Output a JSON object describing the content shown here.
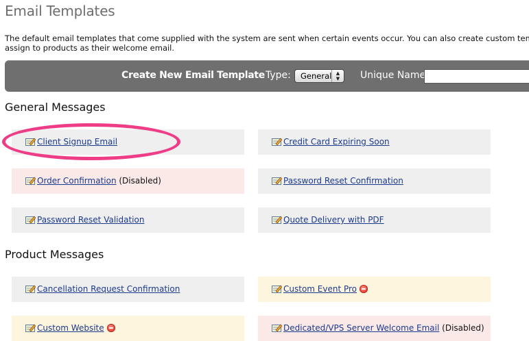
{
  "page": {
    "title": "Email Templates",
    "intro_line1": "The default email templates that come supplied with the system are sent when certain events occur. You can also create custom templates which you can",
    "intro_line2": "assign to products as their welcome email."
  },
  "create_bar": {
    "title": "Create New Email Template",
    "type_label": "Type:",
    "type_value": "General",
    "unique_name_label": "Unique Name:",
    "unique_name_value": ""
  },
  "sections": {
    "general_title": "General Messages",
    "product_title": "Product Messages"
  },
  "general_templates": [
    {
      "label": "Client Signup Email",
      "suffix": "",
      "status": "normal"
    },
    {
      "label": "Credit Card Expiring Soon",
      "suffix": "",
      "status": "normal"
    },
    {
      "label": "Order Confirmation",
      "suffix": " (Disabled)",
      "status": "disabled"
    },
    {
      "label": "Password Reset Confirmation",
      "suffix": "",
      "status": "normal"
    },
    {
      "label": "Password Reset Validation",
      "suffix": "",
      "status": "normal"
    },
    {
      "label": "Quote Delivery with PDF",
      "suffix": "",
      "status": "normal"
    }
  ],
  "product_templates": [
    {
      "label": "Cancellation Request Confirmation",
      "suffix": "",
      "status": "normal"
    },
    {
      "label": "Custom Event Pro",
      "suffix": "",
      "status": "custom",
      "delete_icon": "delete-icon"
    },
    {
      "label": "Custom Website",
      "suffix": "",
      "status": "custom",
      "delete_icon": "delete-icon"
    },
    {
      "label": "Dedicated/VPS Server Welcome Email",
      "suffix": " (Disabled)",
      "status": "disabled"
    }
  ],
  "icons": {
    "edit": "edit-template-icon",
    "delete": "delete-icon"
  },
  "colors": {
    "normal_bg": "#efefef",
    "disabled_bg": "#fbe9e7",
    "custom_bg": "#fdf5dd",
    "link": "#1b3a8c",
    "bar_bg": "#6f6f6f",
    "annotation": "#ee3d86"
  }
}
